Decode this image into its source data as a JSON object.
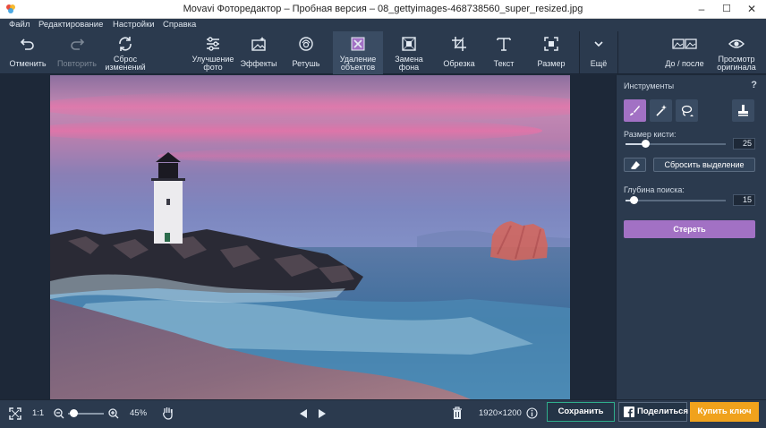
{
  "window": {
    "title": "Movavi Фоторедактор – Пробная версия – 08_gettyimages-468738560_super_resized.jpg",
    "minimize": "–",
    "maximize": "☐",
    "close": "✕"
  },
  "menu": [
    "Файл",
    "Редактирование",
    "Настройки",
    "Справка"
  ],
  "toolbar": {
    "undo": "Отменить",
    "redo": "Повторить",
    "reset_line1": "Сброс",
    "reset_line2": "изменений",
    "enhance_line1": "Улучшение",
    "enhance_line2": "фото",
    "effects": "Эффекты",
    "retouch": "Ретушь",
    "remove_line1": "Удаление",
    "remove_line2": "объектов",
    "replace_line1": "Замена",
    "replace_line2": "фона",
    "crop": "Обрезка",
    "text": "Текст",
    "resize": "Размер",
    "more": "Ещё",
    "before_after": "До / после",
    "view_line1": "Просмотр",
    "view_line2": "оригинала"
  },
  "panel": {
    "title": "Инструменты",
    "help": "?",
    "brush_size_label": "Размер кисти:",
    "brush_size": "25",
    "brush_size_fraction": 0.2,
    "reset_selection": "Сбросить выделение",
    "search_depth_label": "Глубина поиска:",
    "search_depth": "15",
    "search_depth_fraction": 0.08,
    "erase": "Стереть"
  },
  "bottom": {
    "one_to_one": "1:1",
    "zoom": "45%",
    "zoom_fraction": 0.1,
    "dimensions": "1920×1200",
    "save": "Сохранить",
    "share": "Поделиться",
    "buy": "Купить ключ"
  },
  "colors": {
    "accent": "#a271c4",
    "buy": "#f0a21c",
    "save_border": "#2fae8c",
    "panel": "#2b3a4e"
  }
}
